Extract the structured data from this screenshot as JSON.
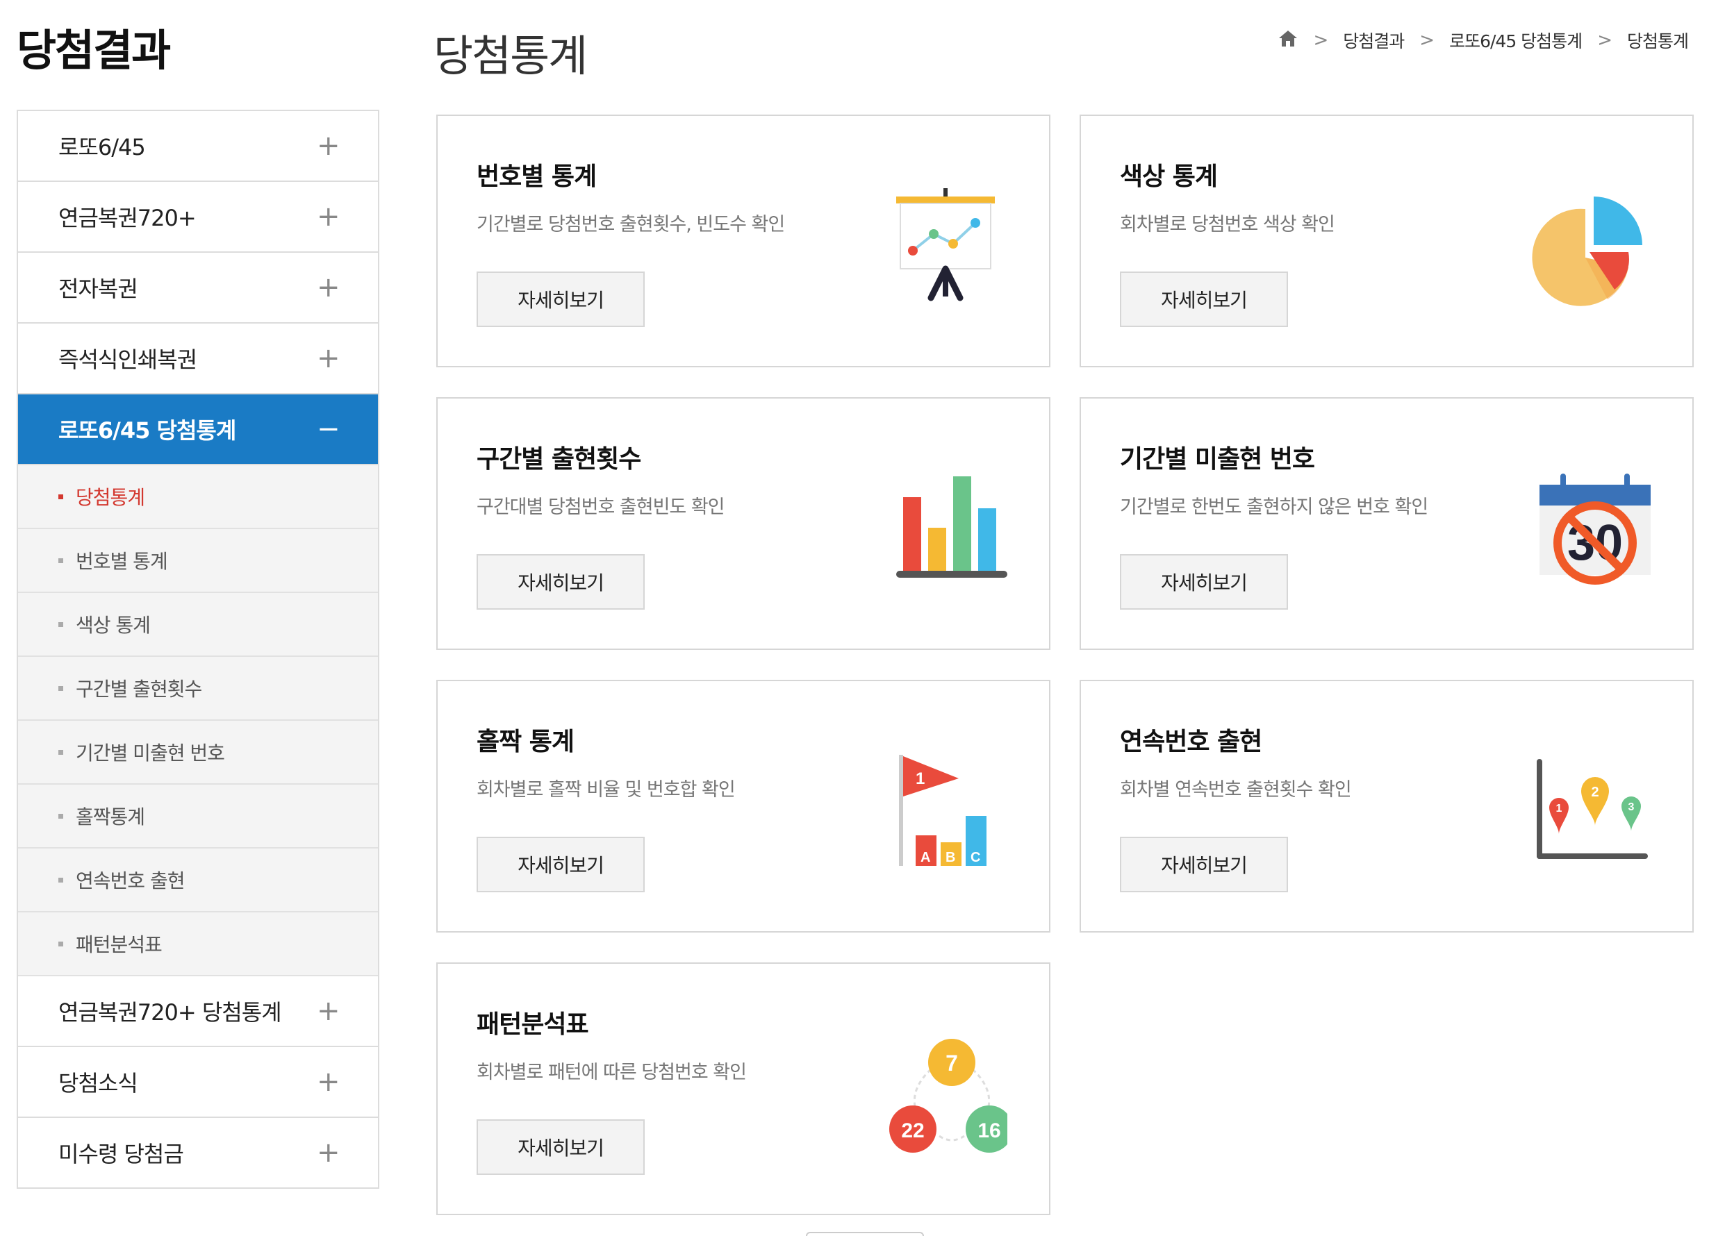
{
  "sidebar": {
    "title": "당첨결과",
    "menus_top": [
      {
        "label": "로또6/45",
        "icon": "plus-icon"
      },
      {
        "label": "연금복권720+",
        "icon": "plus-icon"
      },
      {
        "label": "전자복권",
        "icon": "plus-icon"
      },
      {
        "label": "즉석식인쇄복권",
        "icon": "plus-icon"
      }
    ],
    "active_menu": {
      "label": "로또6/45 당첨통계",
      "icon": "minus-icon"
    },
    "sub_items": [
      {
        "label": "당첨통계",
        "current": true
      },
      {
        "label": "번호별 통계"
      },
      {
        "label": "색상 통계"
      },
      {
        "label": "구간별 출현횟수"
      },
      {
        "label": "기간별 미출현 번호"
      },
      {
        "label": "홀짝통계"
      },
      {
        "label": "연속번호 출현"
      },
      {
        "label": "패턴분석표"
      }
    ],
    "menus_bottom": [
      {
        "label": "연금복권720+ 당첨통계",
        "icon": "plus-icon"
      },
      {
        "label": "당첨소식",
        "icon": "plus-icon"
      },
      {
        "label": "미수령 당첨금",
        "icon": "plus-icon"
      }
    ],
    "plus_symbol": "+",
    "minus_symbol": "−"
  },
  "header": {
    "title": "당첨통계",
    "breadcrumb": [
      "당첨결과",
      "로또6/45 당첨통계",
      "당첨통계"
    ],
    "separator": ">"
  },
  "cards": [
    {
      "title": "번호별 통계",
      "desc": "기간별로 당첨번호 출현횟수, 빈도수 확인",
      "button": "자세히보기",
      "icon": "presentation-chart-icon"
    },
    {
      "title": "색상 통계",
      "desc": "회차별로 당첨번호 색상 확인",
      "button": "자세히보기",
      "icon": "pie-chart-icon"
    },
    {
      "title": "구간별 출현횟수",
      "desc": "구간대별 당첨번호 출현빈도 확인",
      "button": "자세히보기",
      "icon": "bar-chart-icon"
    },
    {
      "title": "기간별 미출현 번호",
      "desc": "기간별로 한번도 출현하지 않은 번호 확인",
      "button": "자세히보기",
      "icon": "calendar-no-icon",
      "icon_text": "30"
    },
    {
      "title": "홀짝 통계",
      "desc": "회차별로 홀짝 비율 및 번호합 확인",
      "button": "자세히보기",
      "icon": "flag-bars-icon",
      "icon_text": [
        "1",
        "A",
        "B",
        "C"
      ]
    },
    {
      "title": "연속번호 출현",
      "desc": "회차별 연속번호 출현횟수 확인",
      "button": "자세히보기",
      "icon": "map-pins-icon",
      "icon_text": [
        "1",
        "2",
        "3"
      ]
    },
    {
      "title": "패턴분석표",
      "desc": "회차별로 패턴에 따른 당첨번호 확인",
      "button": "자세히보기",
      "icon": "number-balls-icon",
      "icon_text": [
        "7",
        "22",
        "16"
      ]
    }
  ],
  "colors": {
    "accent_blue": "#1a7bc5",
    "current_red": "#d3382f",
    "ball_yellow": "#f5b933",
    "ball_red": "#e94b3c",
    "ball_green": "#6ac48a",
    "bar_blue": "#40b8e8"
  }
}
